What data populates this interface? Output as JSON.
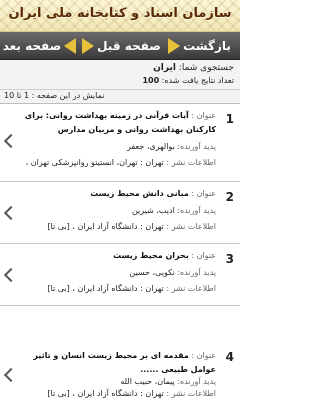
{
  "header": {
    "title": "سازمان اسناد و کتابخانه ملی ایران"
  },
  "nav": {
    "next": "صفحه بعد",
    "prev": "صفحه قبل",
    "back": "بازگشت"
  },
  "search": {
    "term_label": "جستجوی شما:",
    "term_value": "ایران",
    "count_label": "تعداد نتایج یافت شده:",
    "count_value": "100",
    "page_label": "نمایش در این صفحه : 1 تا 10"
  },
  "labels": {
    "title": "عنوان :",
    "author": "پدید آورنده:",
    "publication": "اطلاعات نشر :"
  },
  "records": [
    {
      "number": "1",
      "title_line1": "آیات قرآنی در زمینه بهداشت روانی: برای",
      "title_line2": "کارکنان بهداشت روانی و مربیان مدارس",
      "author": "بوالهری، جعفر",
      "publication": "تهران : تهران، انستیتو روانپزشکی تهران ،"
    },
    {
      "number": "2",
      "title_line1": "مبانی دانش محیط زیست",
      "author": "ادیب، شیرین",
      "publication": "تهران : دانشگاه آزاد ایران ، [بی تا]"
    },
    {
      "number": "3",
      "title_line1": "بحران محیط زیست",
      "author": "نکویی، حسین",
      "publication": "تهران : دانشگاه آزاد ایران ، [بی تا]"
    },
    {
      "number": "4",
      "title_line1": "مقدمه ای بر محیط زیست انسان و تاثیر",
      "title_line2": "عوامل طبیعی ......",
      "author": "پیمان، حبیب الله",
      "publication": "تهران : دانشگاه آزاد ایران ، [بی تا]"
    }
  ]
}
